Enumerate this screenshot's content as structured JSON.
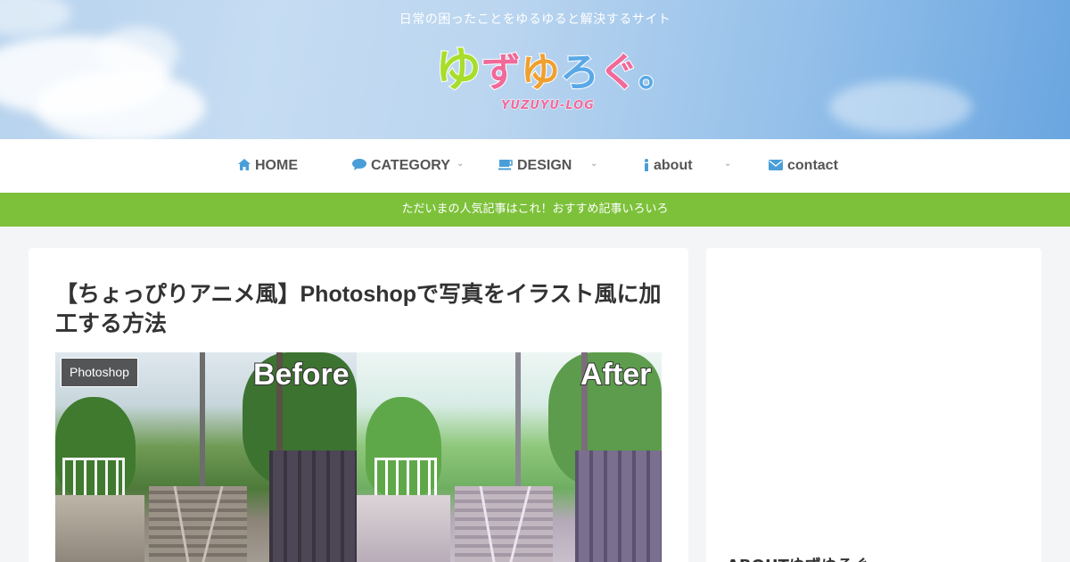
{
  "site": {
    "tagline": "日常の困ったことをゆるゆると解決するサイト",
    "logo_text": "ゆずゆろぐ。",
    "logo_chars": [
      {
        "char": "ゆ",
        "color": "#a8dd2c"
      },
      {
        "char": "ず",
        "color": "#f06a9a"
      },
      {
        "char": "ゆ",
        "color": "#f0a030"
      },
      {
        "char": "ろ",
        "color": "#5aa9e6"
      },
      {
        "char": "ぐ",
        "color": "#f06a9a"
      },
      {
        "char": "。",
        "color": "#5aa9e6"
      }
    ],
    "logo_sub": "YUZUYU-LOG"
  },
  "nav": {
    "items": [
      {
        "label": "HOME",
        "icon": "home-icon",
        "has_dropdown": false
      },
      {
        "label": "CATEGORY",
        "icon": "comment-icon",
        "has_dropdown": true
      },
      {
        "label": "DESIGN",
        "icon": "coffee-icon",
        "has_dropdown": true
      },
      {
        "label": "about",
        "icon": "info-icon",
        "has_dropdown": true
      },
      {
        "label": "contact",
        "icon": "envelope-icon",
        "has_dropdown": false
      }
    ]
  },
  "notice": {
    "text": "ただいまの人気記事はこれ！おすすめ記事いろいろ"
  },
  "post": {
    "title": "【ちょっぴりアニメ風】Photoshopで写真をイラスト風に加工する方法",
    "category": "Photoshop",
    "eyecatch": {
      "before_label": "Before",
      "after_label": "After"
    }
  },
  "sidebar": {
    "heading": "ABOUTゆずゆろぐ"
  },
  "colors": {
    "accent_blue": "#4a9ed8",
    "notice_green": "#7dc13a",
    "background": "#f4f5f7"
  }
}
